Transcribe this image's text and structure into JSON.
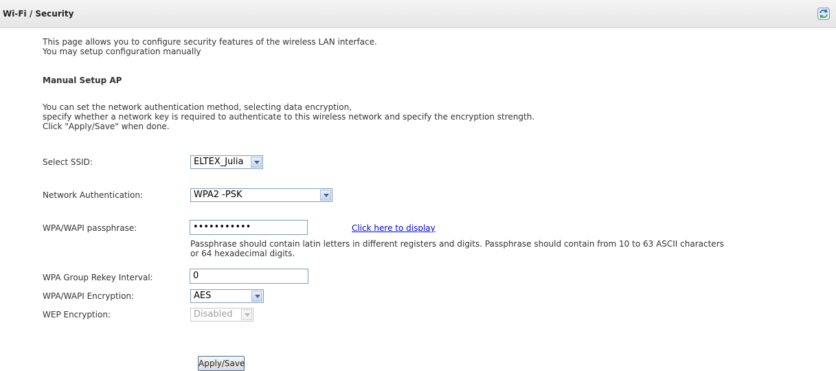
{
  "header": {
    "title": "Wi-Fi / Security"
  },
  "intro": {
    "line1": "This page allows you to configure security features of the wireless LAN interface.",
    "line2": "You may setup configuration manually"
  },
  "section": {
    "title": "Manual Setup AP"
  },
  "description": {
    "line1": "You can set the network authentication method, selecting data encryption,",
    "line2": "specify whether a network key is required to authenticate to this wireless network and specify the encryption strength.",
    "line3": "Click \"Apply/Save\" when done."
  },
  "form": {
    "ssid": {
      "label": "Select SSID:",
      "value": "ELTEX_Julia"
    },
    "auth": {
      "label": "Network Authentication:",
      "value": "WPA2 -PSK"
    },
    "passphrase": {
      "label": "WPA/WAPI passphrase:",
      "value": "•••••••••••",
      "link": "Click here to display",
      "hint_line1": "Passphrase should contain latin letters in different registers and digits. Passphrase should contain from 10 to 63 ASCII characters",
      "hint_line2": "or 64 hexadecimal digits."
    },
    "rekey": {
      "label": "WPA Group Rekey Interval:",
      "value": "0"
    },
    "encryption": {
      "label": "WPA/WAPI Encryption:",
      "value": "AES"
    },
    "wep": {
      "label": "WEP Encryption:",
      "value": "Disabled"
    }
  },
  "actions": {
    "apply_label": "Apply/Save"
  }
}
